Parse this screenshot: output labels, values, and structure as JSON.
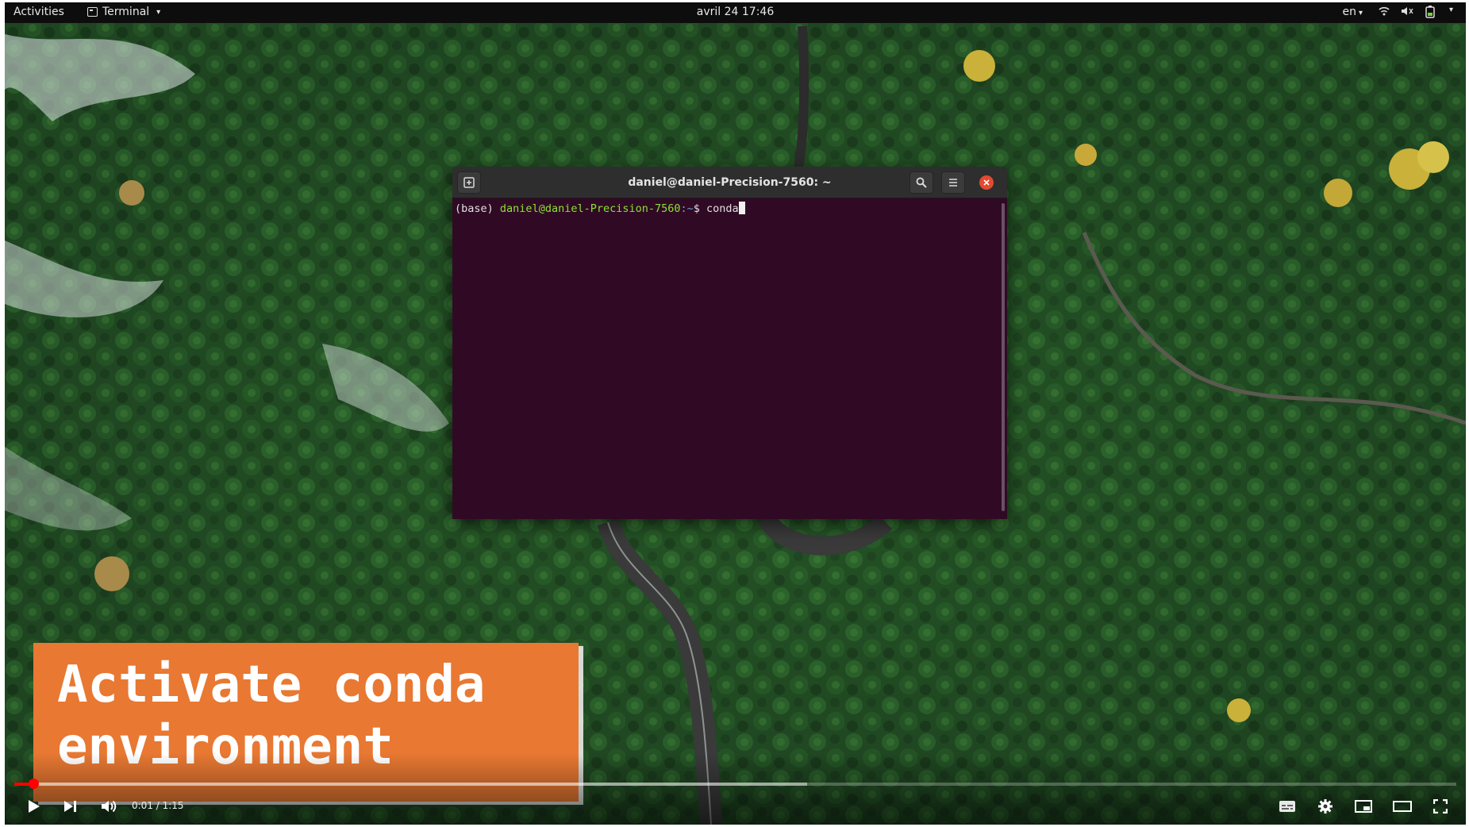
{
  "topbar": {
    "activities": "Activities",
    "app_name": "Terminal",
    "clock": "avril 24  17:46",
    "language": "en"
  },
  "terminal": {
    "title": "daniel@daniel-Precision-7560: ~",
    "prompt_env": "(base)",
    "prompt_user": "daniel@daniel-Precision-7560",
    "prompt_path": ":~",
    "prompt_symbol": "$",
    "command": "conda",
    "background_color": "#300a24"
  },
  "caption": {
    "line1": "Activate conda",
    "line2": "environment",
    "color": "#e87832"
  },
  "player": {
    "time_display": "0:01 / 1:15",
    "progress_played": 0.013,
    "progress_buffered": 0.55,
    "accent_color": "#ff0000"
  },
  "icons": {
    "topbar_tray": [
      "wifi-icon",
      "volume-muted-icon",
      "battery-icon",
      "power-menu-icon"
    ],
    "player_controls": [
      "play-icon",
      "next-icon",
      "volume-icon",
      "subtitles-icon",
      "settings-icon",
      "miniplayer-icon",
      "theater-mode-icon",
      "fullscreen-icon"
    ]
  }
}
